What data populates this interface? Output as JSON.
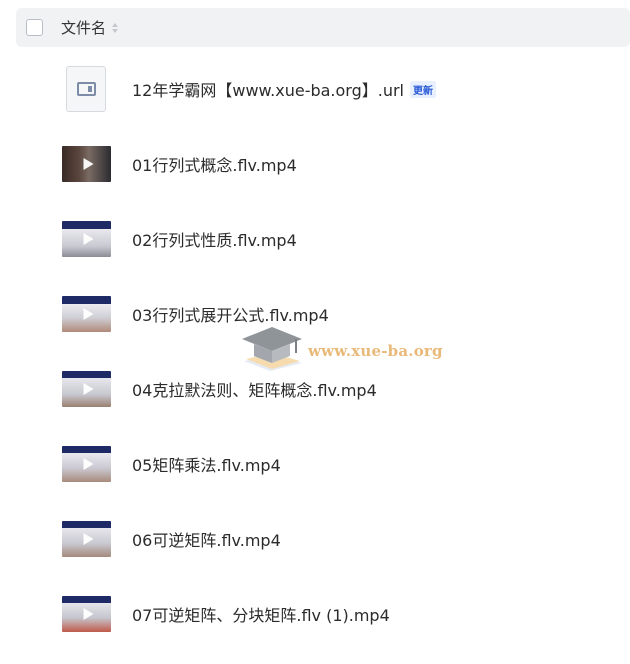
{
  "header": {
    "column_label": "文件名"
  },
  "files": [
    {
      "name": "12年学霸网【www.xue-ba.org】.url",
      "badge": "更新",
      "type": "url"
    },
    {
      "name": "01行列式概念.flv.mp4",
      "type": "video"
    },
    {
      "name": "02行列式性质.flv.mp4",
      "type": "video"
    },
    {
      "name": "03行列式展开公式.flv.mp4",
      "type": "video"
    },
    {
      "name": "04克拉默法则、矩阵概念.flv.mp4",
      "type": "video"
    },
    {
      "name": "05矩阵乘法.flv.mp4",
      "type": "video"
    },
    {
      "name": "06可逆矩阵.flv.mp4",
      "type": "video"
    },
    {
      "name": "07可逆矩阵、分块矩阵.flv (1).mp4",
      "type": "video"
    }
  ],
  "watermark": {
    "text": "www.xue-ba.org"
  },
  "colors": {
    "header_bg": "#f1f2f4",
    "badge_bg": "#e8f0ff",
    "badge_text": "#2a5bd7",
    "watermark": "#e9b97a"
  }
}
